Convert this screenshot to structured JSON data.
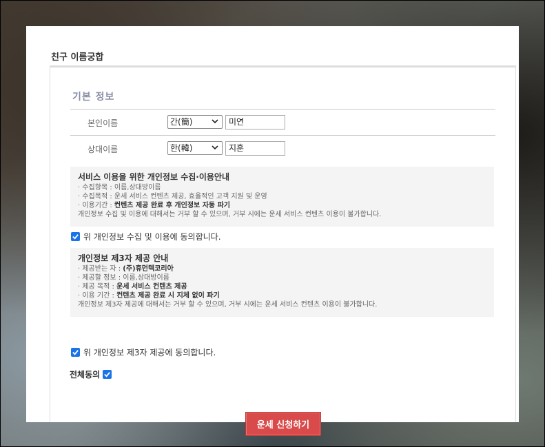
{
  "page_title": "친구 이름궁합",
  "section_title": "기본 정보",
  "rows": [
    {
      "label": "본인이름",
      "select_value": "간(簡)",
      "name_value": "미연"
    },
    {
      "label": "상대이름",
      "select_value": "한(韓)",
      "name_value": "지훈"
    }
  ],
  "privacy_info": {
    "title": "서비스 이용을 위한 개인정보 수집·이용안내",
    "line1": "· 수집항목 : 이름,상대방이름",
    "line2": "· 수집목적 : 운세 서비스 컨텐츠 제공, 효율적인 고객 지원 및 운영",
    "line3_prefix": "· 이용기간 : ",
    "line3_bold": "컨텐츠 제공 완료 후 개인정보 자동 파기",
    "line4": "개인정보 수집 및 이용에 대해서는 거부 할 수 있으며, 거부 시에는 운세 서비스 컨텐츠 이용이 불가합니다."
  },
  "privacy_agree_label": "위 개인정보 수집 및 이용에 동의합니다.",
  "third_party_info": {
    "title": "개인정보 제3자 제공 안내",
    "line1_prefix": "· 제공받는 자 : ",
    "line1_bold": "(주)휴먼텍코리아",
    "line2": "· 제공할 정보 : 이름,상대방이름",
    "line3_prefix": "· 제공 목적 : ",
    "line3_bold": "운세 서비스 컨텐츠 제공",
    "line4_prefix": "· 이용 기간 : ",
    "line4_bold": "컨텐츠 제공 완료 시 지체 없이 파기",
    "line5": "개인정보 제3자 제공에 대해서는 거부 할 수 있으며, 거부 시에는 운세 서비스 컨텐츠 이용이 불가합니다."
  },
  "third_party_agree_label": "위 개인정보 제3자 제공에 동의합니다.",
  "all_agree_label": "전체동의",
  "submit_label": "운세 신청하기",
  "colors": {
    "accent": "#d94a4a",
    "checkbox": "#1a73e8",
    "section_title": "#8a8fa8"
  }
}
